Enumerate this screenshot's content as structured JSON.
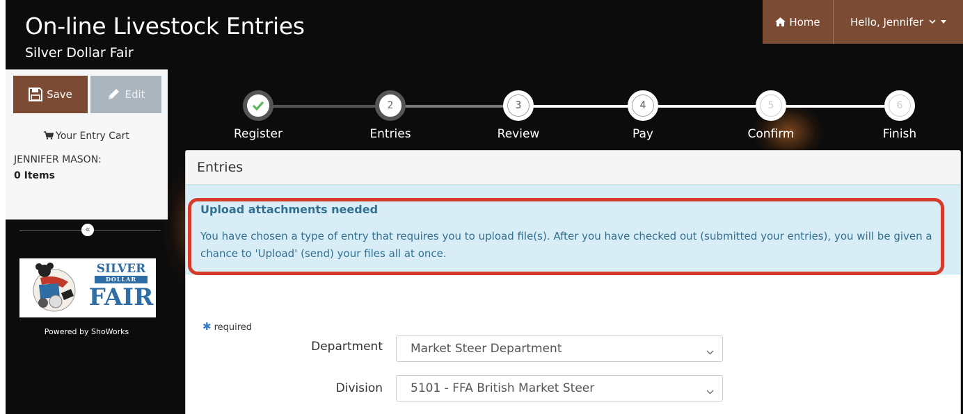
{
  "header": {
    "title": "On-line Livestock Entries",
    "subtitle": "Silver Dollar Fair",
    "home_label": "Home",
    "user_label": "Hello, Jennifer"
  },
  "sidebar": {
    "save_label": "Save",
    "edit_label": "Edit",
    "cart_label": "Your Entry Cart",
    "cart_name": "JENNIFER MASON:",
    "cart_count": "0 Items",
    "collapse_glyph": "«",
    "logo": {
      "line1": "SILVER",
      "line2": "DOLLAR",
      "line3": "FAIR"
    },
    "powered_by": "Powered by ShoWorks"
  },
  "wizard": {
    "steps": [
      {
        "number": "",
        "label": "Register",
        "state": "complete"
      },
      {
        "number": "2",
        "label": "Entries",
        "state": "current"
      },
      {
        "number": "3",
        "label": "Review",
        "state": "upcoming"
      },
      {
        "number": "4",
        "label": "Pay",
        "state": "upcoming"
      },
      {
        "number": "5",
        "label": "Confirm",
        "state": "disabled"
      },
      {
        "number": "6",
        "label": "Finish",
        "state": "disabled"
      }
    ]
  },
  "panel": {
    "title": "Entries",
    "alert_title": "Upload attachments needed",
    "alert_body": "You have chosen a type of entry that requires you to upload file(s). After you have checked out (submitted your entries), you will be given a chance to 'Upload' (send) your files all at once.",
    "required_note": "required",
    "department_label": "Department",
    "department_value": "Market Steer Department",
    "division_label": "Division",
    "division_value": "5101 - FFA British Market Steer"
  },
  "icons": [
    "home-icon",
    "chevron-down-icon",
    "caret-down-icon",
    "save-icon",
    "pencil-icon",
    "cart-icon",
    "check-icon",
    "asterisk-icon"
  ],
  "colors": {
    "brand_brown": "#7b4b34",
    "alert_bg": "#d9edf7",
    "alert_text": "#31708f",
    "highlight_red": "#d43b2a",
    "check_green": "#5cb85c"
  }
}
